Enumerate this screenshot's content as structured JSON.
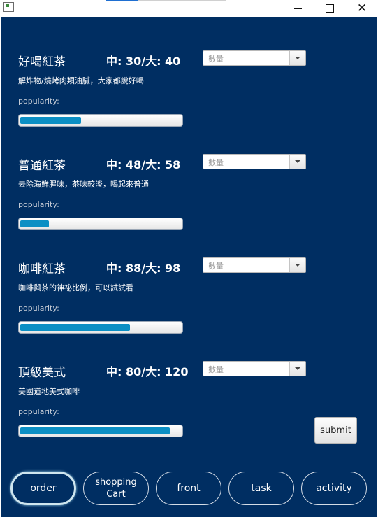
{
  "window": {
    "minimize_label": "",
    "close_glyph": "✕"
  },
  "products": [
    {
      "name": "好喝紅茶",
      "price": "中: 30/大: 40",
      "qty_placeholder": "數量",
      "description": "解炸物/燒烤肉類油膩，大家都說好喝",
      "popularity_label": "popularity:",
      "popularity": 0.38
    },
    {
      "name": "普通紅茶",
      "price": "中: 48/大: 58",
      "qty_placeholder": "數量",
      "description": "去除海鮮腥味，茶味較淡，喝起來普通",
      "popularity_label": "popularity:",
      "popularity": 0.18
    },
    {
      "name": "咖啡紅茶",
      "price": "中: 88/大: 98",
      "qty_placeholder": "數量",
      "description": "咖啡與茶的神祕比例，可以試試看",
      "popularity_label": "popularity:",
      "popularity": 0.69
    },
    {
      "name": "頂級美式",
      "price": "中: 80/大: 120",
      "qty_placeholder": "數量",
      "description": "美國道地美式咖啡",
      "popularity_label": "popularity:",
      "popularity": 0.94
    }
  ],
  "submit_label": "submit",
  "nav": {
    "order": "order",
    "shopping_cart_line1": "shopping",
    "shopping_cart_line2": "Cart",
    "front": "front",
    "task": "task",
    "activity": "activity"
  },
  "colors": {
    "panel_bg": "#002e62",
    "progress_fill": "#0b8fc4",
    "text": "#ffffff"
  }
}
